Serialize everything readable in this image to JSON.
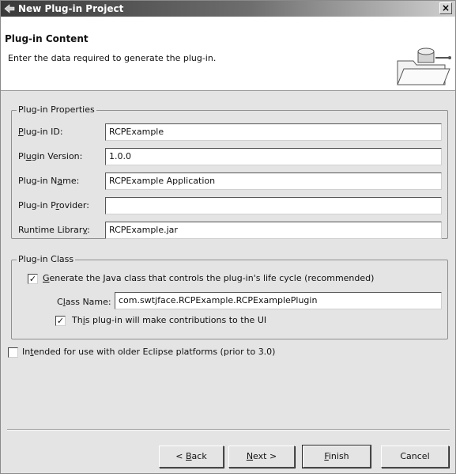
{
  "window": {
    "title": "New Plug-in Project",
    "close_glyph": "×"
  },
  "header": {
    "title": "Plug-in Content",
    "description": "Enter the data required to generate the plug-in.",
    "banner_icon": "folder-wizard-banner"
  },
  "properties": {
    "legend": "Plug-in Properties",
    "fields": [
      {
        "label_pre": "",
        "label_acc": "P",
        "label_post": "lug-in ID:",
        "value": "RCPExample"
      },
      {
        "label_pre": "Pl",
        "label_acc": "u",
        "label_post": "gin Version:",
        "value": "1.0.0"
      },
      {
        "label_pre": "Plug-in N",
        "label_acc": "a",
        "label_post": "me:",
        "value": "RCPExample Application"
      },
      {
        "label_pre": "Plug-in P",
        "label_acc": "r",
        "label_post": "ovider:",
        "value": ""
      },
      {
        "label_pre": "Runtime Librar",
        "label_acc": "y",
        "label_post": ":",
        "value": "RCPExample.jar"
      }
    ]
  },
  "plugin_class": {
    "legend": "Plug-in Class",
    "generate": {
      "checked": true,
      "pre": "",
      "acc": "G",
      "post": "enerate the Java class that controls the plug-in's life cycle (recommended)"
    },
    "class_name": {
      "pre": "C",
      "acc": "l",
      "post": "ass Name:",
      "value": "com.swtjface.RCPExample.RCPExamplePlugin"
    },
    "ui": {
      "checked": true,
      "pre": "Th",
      "acc": "i",
      "post": "s plug-in will make contributions to the UI"
    }
  },
  "legacy": {
    "checked": false,
    "pre": "In",
    "acc": "t",
    "post": "ended for use with older Eclipse platforms (prior to 3.0)"
  },
  "buttons": {
    "back": {
      "pre": "< ",
      "acc": "B",
      "post": "ack"
    },
    "next": {
      "pre": "",
      "acc": "N",
      "post": "ext >"
    },
    "finish": {
      "pre": "",
      "acc": "F",
      "post": "inish"
    },
    "cancel": {
      "label": "Cancel"
    }
  },
  "check_glyph": "✓"
}
